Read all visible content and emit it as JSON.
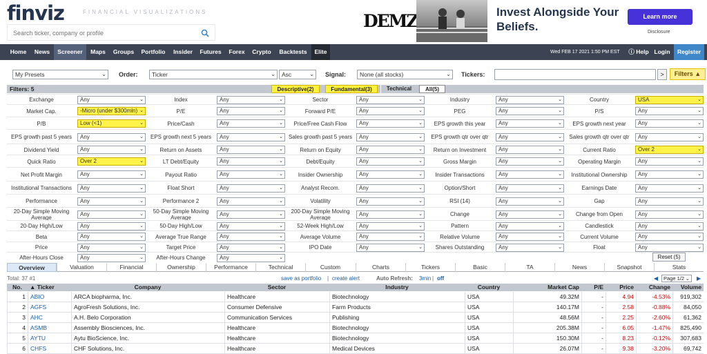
{
  "header": {
    "logo": "finviz",
    "tagline": "FINANCIAL VISUALIZATIONS",
    "search_placeholder": "Search ticker, company or profile"
  },
  "ad": {
    "brand": "DEMZ",
    "headline": "Invest Alongside Your Beliefs.",
    "cta": "Learn more",
    "disclosure": "Disclosure"
  },
  "nav": {
    "items": [
      "Home",
      "News",
      "Screener",
      "Maps",
      "Groups",
      "Portfolio",
      "Insider",
      "Futures",
      "Forex",
      "Crypto",
      "Backtests",
      "Elite"
    ],
    "active": "Screener",
    "datetime": "Wed FEB 17 2021 1:50 PM EST",
    "help": "Help",
    "login": "Login",
    "register": "Register"
  },
  "presets": {
    "preset": "My Presets",
    "order_label": "Order:",
    "order_value": "Ticker",
    "direction": "Asc",
    "signal_label": "Signal:",
    "signal_value": "None (all stocks)",
    "tickers_label": "Tickers:",
    "go": ">",
    "filters_button": "Filters ▲"
  },
  "filter_tabs": {
    "count": "Filters: 5",
    "tabs": [
      "Descriptive(2)",
      "Fundamental(3)",
      "Technical",
      "All(5)"
    ]
  },
  "filters": [
    [
      "Exchange",
      "Any",
      "Index",
      "Any",
      "Sector",
      "Any",
      "Industry",
      "Any",
      "Country",
      "USA"
    ],
    [
      "Market Cap.",
      "-Micro (under $300mln)",
      "P/E",
      "Any",
      "Forward P/E",
      "Any",
      "PEG",
      "Any",
      "P/S",
      "Any"
    ],
    [
      "P/B",
      "Low (<1)",
      "Price/Cash",
      "Any",
      "Price/Free Cash Flow",
      "Any",
      "EPS growth this year",
      "Any",
      "EPS growth next year",
      "Any"
    ],
    [
      "EPS growth past 5 years",
      "Any",
      "EPS growth next 5 years",
      "Any",
      "Sales growth past 5 years",
      "Any",
      "EPS growth qtr over qtr",
      "Any",
      "Sales growth qtr over qtr",
      "Any"
    ],
    [
      "Dividend Yield",
      "Any",
      "Return on Assets",
      "Any",
      "Return on Equity",
      "Any",
      "Return on Investment",
      "Any",
      "Current Ratio",
      "Over 2"
    ],
    [
      "Quick Ratio",
      "Over 2",
      "LT Debt/Equity",
      "Any",
      "Debt/Equity",
      "Any",
      "Gross Margin",
      "Any",
      "Operating Margin",
      "Any"
    ],
    [
      "Net Profit Margin",
      "Any",
      "Payout Ratio",
      "Any",
      "Insider Ownership",
      "Any",
      "Insider Transactions",
      "Any",
      "Institutional Ownership",
      "Any"
    ],
    [
      "Institutional Transactions",
      "Any",
      "Float Short",
      "Any",
      "Analyst Recom.",
      "Any",
      "Option/Short",
      "Any",
      "Earnings Date",
      "Any"
    ],
    [
      "Performance",
      "Any",
      "Performance 2",
      "Any",
      "Volatility",
      "Any",
      "RSI (14)",
      "Any",
      "Gap",
      "Any"
    ],
    [
      "20-Day Simple Moving Average",
      "Any",
      "50-Day Simple Moving Average",
      "Any",
      "200-Day Simple Moving Average",
      "Any",
      "Change",
      "Any",
      "Change from Open",
      "Any"
    ],
    [
      "20-Day High/Low",
      "Any",
      "50-Day High/Low",
      "Any",
      "52-Week High/Low",
      "Any",
      "Pattern",
      "Any",
      "Candlestick",
      "Any"
    ],
    [
      "Beta",
      "Any",
      "Average True Range",
      "Any",
      "Average Volume",
      "Any",
      "Relative Volume",
      "Any",
      "Current Volume",
      "Any"
    ],
    [
      "Price",
      "Any",
      "Target Price",
      "Any",
      "IPO Date",
      "Any",
      "Shares Outstanding",
      "Any",
      "Float",
      "Any"
    ],
    [
      "After-Hours Close",
      "Any",
      "After-Hours Change",
      "Any"
    ]
  ],
  "highlighted_filters": [
    "Country",
    "Market Cap.",
    "P/B",
    "Current Ratio",
    "Quick Ratio"
  ],
  "reset_label": "Reset (5)",
  "view_tabs": [
    "Overview",
    "Valuation",
    "Financial",
    "Ownership",
    "Performance",
    "Technical",
    "Custom",
    "Charts",
    "Tickers",
    "Basic",
    "TA",
    "News",
    "Snapshot",
    "Stats"
  ],
  "active_view": "Overview",
  "results": {
    "total": "Total: 37 #1",
    "save_portfolio": "save as portfolio",
    "separator": "|",
    "create_alert": "create alert",
    "auto_refresh": "Auto Refresh:",
    "refresh_interval": "3min",
    "refresh_off": "off",
    "page": "Page 1/2"
  },
  "table": {
    "headers": [
      "No.",
      "▲ Ticker",
      "Company",
      "Sector",
      "Industry",
      "Country",
      "Market Cap",
      "P/E",
      "Price",
      "Change",
      "Volume"
    ],
    "rows": [
      [
        "1",
        "ABIO",
        "ARCA biopharma, Inc.",
        "Healthcare",
        "Biotechnology",
        "USA",
        "49.32M",
        "-",
        "4.94",
        "-4.53%",
        "919,302"
      ],
      [
        "2",
        "AGFS",
        "AgroFresh Solutions, Inc.",
        "Consumer Defensive",
        "Farm Products",
        "USA",
        "140.17M",
        "-",
        "2.58",
        "-0.88%",
        "84,050"
      ],
      [
        "3",
        "AHC",
        "A.H. Belo Corporation",
        "Communication Services",
        "Publishing",
        "USA",
        "48.56M",
        "-",
        "2.25",
        "-2.60%",
        "61,362"
      ],
      [
        "4",
        "ASMB",
        "Assembly Biosciences, Inc.",
        "Healthcare",
        "Biotechnology",
        "USA",
        "205.38M",
        "-",
        "6.05",
        "-1.47%",
        "825,490"
      ],
      [
        "5",
        "AYTU",
        "Aytu BioScience, Inc.",
        "Healthcare",
        "Biotechnology",
        "USA",
        "150.30M",
        "-",
        "8.23",
        "-0.12%",
        "307,683"
      ],
      [
        "6",
        "CHFS",
        "CHF Solutions, Inc.",
        "Healthcare",
        "Medical Devices",
        "USA",
        "26.07M",
        "-",
        "9.38",
        "-3.20%",
        "69,742"
      ]
    ]
  },
  "colors": {
    "nav_bg": "#3c4453",
    "highlight": "#fff34a",
    "negative": "#c41010",
    "link": "#1e5fa8",
    "register_bg": "#3f87c8",
    "ad_cta": "#4731d9"
  }
}
